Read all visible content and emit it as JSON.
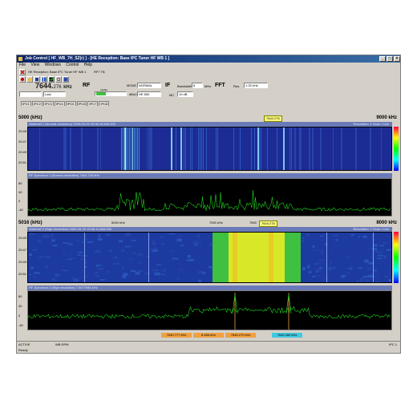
{
  "window": {
    "title": "Job Control [ HF_WB_7H_SZ(r) ] - [HE Reception: Base IPC Tuner HF WB 1 ]",
    "controls": [
      "_",
      "□",
      "×"
    ]
  },
  "menu": [
    "File",
    "View",
    "Windows",
    "Control",
    "Help"
  ],
  "reception": {
    "header": "HE Reception: Base IPC Tuner HF WB 1",
    "frequency": "7644.",
    "frequency_frac": "276",
    "unit": "kHz",
    "rf_label": "RF",
    "level_label": "LEVEL",
    "level_value": "",
    "mode_label": "MODE",
    "mode_value": "NORMAL",
    "if_label": "IF",
    "bandwidth_label": "Bandwidth",
    "bandwidth_value": "8",
    "bandwidth_unit": "MHz",
    "ifbw_label": "IF BW",
    "ifbw_value": "HE 850",
    "gain_label": "MC",
    "gain_value": "10 dB",
    "fft_label": "FFT",
    "fft_res_label": "Res.",
    "fft_res_value": "1.25 kHz",
    "channel_value": "Last",
    "dbuv_unit": "dBuV"
  },
  "ipc_tabs": [
    "IPC1",
    "IPC2",
    "IPC3",
    "IPC4",
    "IPC5",
    "IPC6",
    "IPC7",
    "IPC8"
  ],
  "overview": {
    "freq_start": "5000 (kHz)",
    "freq_end": "9000 kHz",
    "marker": "7644.276",
    "waterfall_title": "Waterfall 1 (Normal resolution) 2005-09-29 15:36:16,508.000",
    "resolution": "Resolution: 1 Scan / Line",
    "spectrum_title": "RF-Spectrum 1 (Normal resolution) 7644.745 kHz",
    "ticks": [
      "6000 kHz",
      "7000 kHz",
      "8000 kHz"
    ],
    "y_left": [
      "20:45",
      "20:47",
      "20:49",
      "20:51"
    ],
    "y_right": [
      "0",
      "-20",
      "-40",
      "-60",
      "-80"
    ],
    "spec_y": [
      "80",
      "40",
      "0",
      "-40",
      "-80"
    ]
  },
  "zoom": {
    "freq_start": "5016 (kHz)",
    "freq_end": "8000 kHz",
    "marker": "7644.276",
    "marker_near": "7600",
    "waterfall_title": "Waterfall 2 (High resolution) 2005-09-29 15:36:13,508.000",
    "resolution": "Resolution: 1 Scan / Line",
    "spectrum_title": "RF-Spectrum 2 (High resolution) 7.5077688 kHz",
    "ticks": [
      "6000 kHz",
      "7000 kHz"
    ],
    "y_left": [
      "20:45",
      "20:47",
      "20:49",
      "20:51"
    ],
    "y_right": [
      "0",
      "-20",
      "-40",
      "-60",
      "-80"
    ],
    "spec_y": [
      "80",
      "40",
      "0",
      "-40",
      "-80"
    ]
  },
  "bottom_markers": [
    "7640.777 kHz",
    "8.486 kHz",
    "7646.270 kHz",
    "7640.280 kHz"
  ],
  "status": {
    "left": "ACTIVE",
    "mid": "WB RPM",
    "right": "IPC 1",
    "ready": "Ready"
  },
  "colors": {
    "title_bar": "#0a246a",
    "waterfall_bg": "#1a2a8a",
    "spectrum_line": "#1fd21f",
    "marker_orange": "#f0a040",
    "marker_cyan": "#40c8e0"
  }
}
